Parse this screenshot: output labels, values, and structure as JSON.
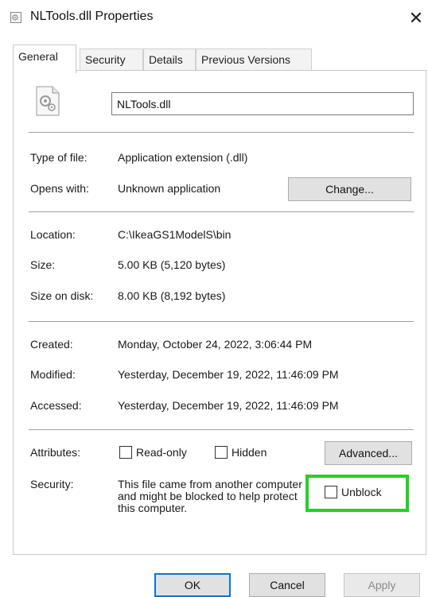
{
  "window": {
    "title": "NLTools.dll Properties",
    "close_glyph": "✕"
  },
  "tabs": [
    {
      "label": "General",
      "active": true
    },
    {
      "label": "Security",
      "active": false
    },
    {
      "label": "Details",
      "active": false
    },
    {
      "label": "Previous Versions",
      "active": false
    }
  ],
  "general": {
    "file_name": "NLTools.dll",
    "type_label": "Type of file:",
    "type_value": "Application extension (.dll)",
    "opens_label": "Opens with:",
    "opens_value": "Unknown application",
    "change_label": "Change...",
    "location_label": "Location:",
    "location_value": "C:\\IkeaGS1ModelS\\bin",
    "size_label": "Size:",
    "size_value": "5.00 KB (5,120 bytes)",
    "size_disk_label": "Size on disk:",
    "size_disk_value": "8.00 KB (8,192 bytes)",
    "created_label": "Created:",
    "created_value": "Monday, October 24, 2022, 3:06:44 PM",
    "modified_label": "Modified:",
    "modified_value": "Yesterday, December 19, 2022, 11:46:09 PM",
    "accessed_label": "Accessed:",
    "accessed_value": "Yesterday, December 19, 2022, 11:46:09 PM",
    "attributes_label": "Attributes:",
    "readonly_label": "Read-only",
    "readonly_checked": false,
    "hidden_label": "Hidden",
    "hidden_checked": false,
    "advanced_label": "Advanced...",
    "security_label": "Security:",
    "security_text": "This file came from another computer and might be blocked to help protect this computer.",
    "unblock_label": "Unblock",
    "unblock_checked": false,
    "highlight_color": "#22d12a"
  },
  "buttons": {
    "ok": "OK",
    "cancel": "Cancel",
    "apply": "Apply"
  },
  "colors": {
    "ok_border": "#0078d7",
    "disabled_text": "#8a8a8a"
  }
}
